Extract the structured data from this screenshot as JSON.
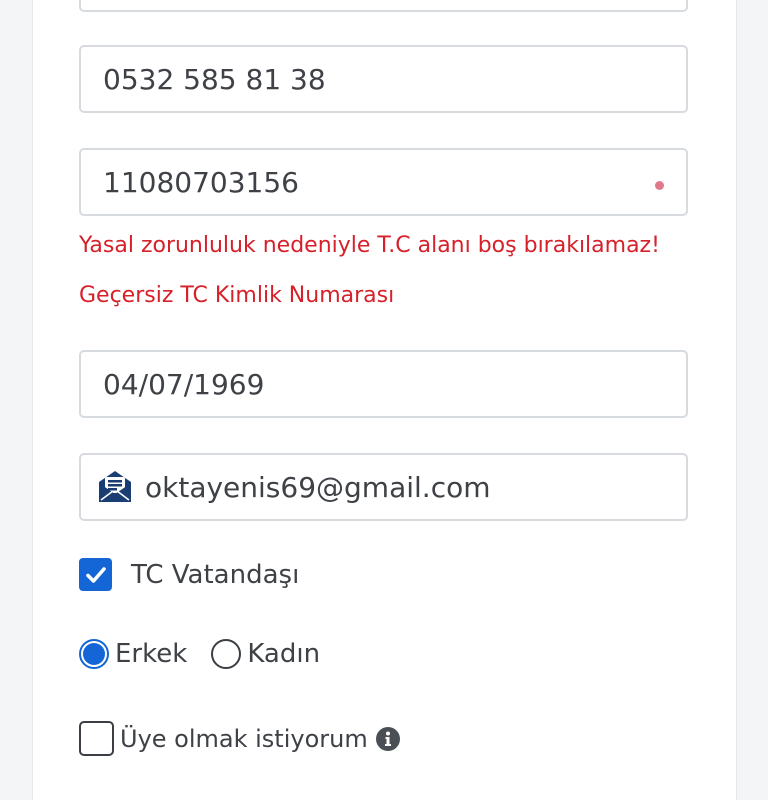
{
  "form": {
    "fields": {
      "top_cut_value": "",
      "phone_value": "0532 585 81 38",
      "tc_value": "11080703156",
      "birthdate_value": "04/07/1969",
      "email_value": "oktayenis69@gmail.com"
    },
    "errors": {
      "tc_required": "Yasal zorunluluk nedeniyle T.C alanı boş bırakılamaz!",
      "tc_invalid": "Geçersiz TC Kimlik Numarası"
    },
    "citizen": {
      "label": "TC Vatandaşı",
      "checked": true
    },
    "gender": {
      "options": [
        "Erkek",
        "Kadın"
      ],
      "selected": "Erkek"
    },
    "membership": {
      "label": "Üye olmak istiyorum",
      "checked": false
    },
    "icons": {
      "email": "mail-envelope-icon",
      "info": "info-icon",
      "required": "required-dot-icon"
    },
    "colors": {
      "accent": "#1466d6",
      "error": "#d6202a",
      "required_dot": "#e07a8a",
      "border": "#d7dade",
      "text": "#3e4146"
    }
  }
}
